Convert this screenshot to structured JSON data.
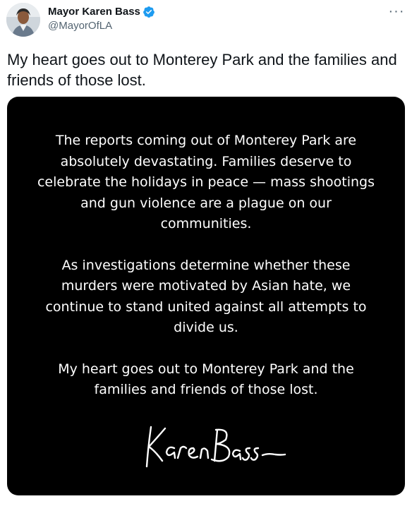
{
  "author": {
    "name": "Mayor Karen Bass",
    "handle": "@MayorOfLA",
    "verified": true,
    "verified_color": "#1d9bf0"
  },
  "more_menu": {
    "label": "···",
    "icon": "more-horizontal-icon"
  },
  "tweet": {
    "text": "My heart goes out to Monterey Park and the families and friends of those lost."
  },
  "image": {
    "background_color": "#000000",
    "text_color": "#ffffff",
    "paragraphs": [
      "The reports coming out of Monterey Park are absolutely devastating. Families deserve to celebrate the holidays in peace — mass shootings and gun violence are a plague on our communities.",
      "As investigations determine whether these murders were motivated by Asian hate, we continue to stand united against all attempts to divide us.",
      "My heart goes out to Monterey Park and the families and friends of those lost."
    ],
    "signature": "KarenBass"
  }
}
